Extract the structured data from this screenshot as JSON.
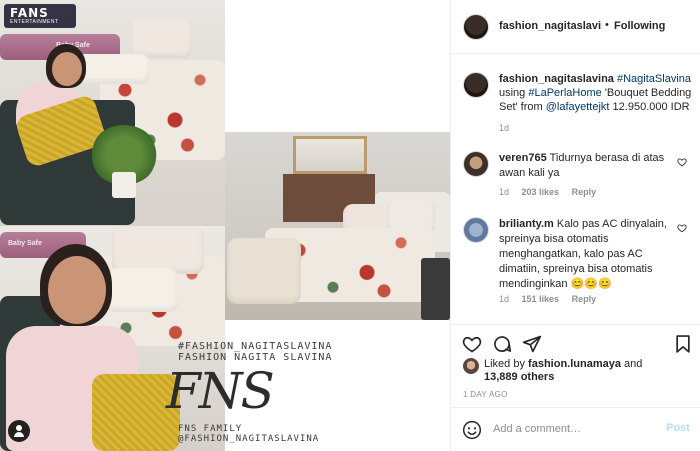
{
  "media": {
    "brand_logo": "FANS",
    "brand_sub": "ENTERTAINMENT",
    "rail_label": "Baby Safe",
    "watermark_top": "#FASHION_NAGITASLAVINA",
    "watermark_top2": "FASHION NAGITA SLAVINA",
    "watermark_big": "FNS",
    "watermark_bottom": "FNS FAMILY",
    "watermark_bottom2": "@FASHION_NAGITASLAVINA",
    "user_tag_icon": "user-tag-icon"
  },
  "header": {
    "username": "fashion_nagitaslavina",
    "separator": "•",
    "follow_status": "Following"
  },
  "caption": {
    "username": "fashion_nagitaslavina",
    "hashtag1": "#NagitaSlavina",
    "text1": "using",
    "hashtag2": "#LaPerlaHome",
    "text2": "'Bouquet Bedding Set' from",
    "mention": "@lafayettejkt",
    "text3": "12.950.000 IDR",
    "time": "1d"
  },
  "comments": [
    {
      "username": "veren765",
      "text": "Tidurnya berasa di atas awan kali ya",
      "time": "1d",
      "likes": "203 likes",
      "reply": "Reply"
    },
    {
      "username": "brilianty.m",
      "text": "Kalo pas AC dinyalain, spreinya bisa otomatis menghangatkan, kalo pas AC dimatiin, spreinya bisa otomatis mendinginkan 😊😊😊",
      "time": "1d",
      "likes": "151 likes",
      "reply": "Reply"
    }
  ],
  "actions": {
    "like_icon": "heart-icon",
    "comment_icon": "comment-icon",
    "share_icon": "share-icon",
    "save_icon": "bookmark-icon"
  },
  "likes": {
    "prefix": "Liked by",
    "liker": "fashion.lunamaya",
    "and": "and",
    "others": "13,889 others"
  },
  "post_date": "1 DAY AGO",
  "comment_box": {
    "emoji_icon": "emoji-icon",
    "placeholder": "Add a comment…",
    "post_label": "Post"
  },
  "colors": {
    "link": "#00376b",
    "muted": "#8e8e8e",
    "post_disabled": "#b2dffc",
    "text": "#262626"
  }
}
